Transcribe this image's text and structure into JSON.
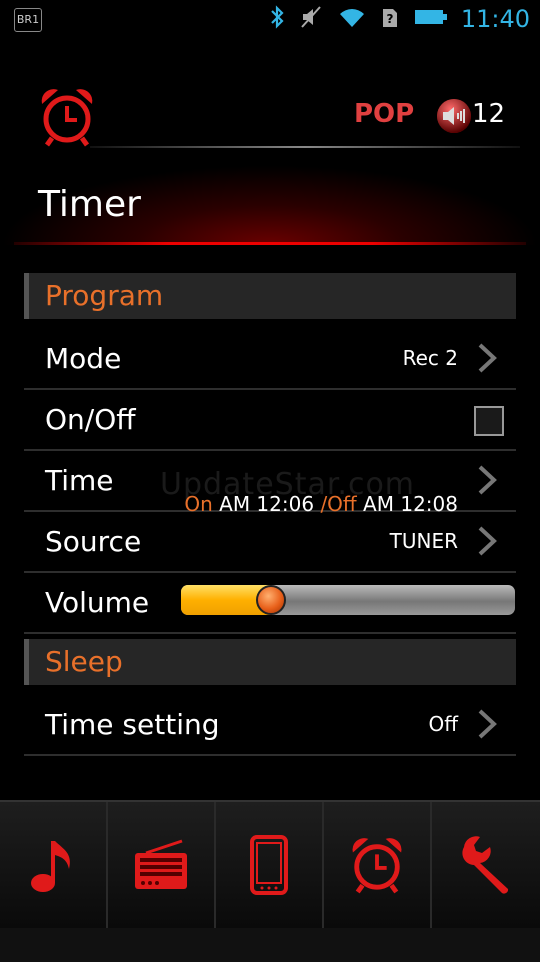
{
  "status_bar": {
    "left_badge": "BR1",
    "time": "11:40",
    "icons": [
      "bluetooth-icon",
      "mute-icon",
      "wifi-icon",
      "sim-unknown-icon",
      "battery-icon"
    ]
  },
  "header": {
    "eq_preset": "POP",
    "volume_level": "12"
  },
  "page": {
    "title": "Timer"
  },
  "sections": {
    "program": "Program",
    "sleep": "Sleep"
  },
  "rows": {
    "mode": {
      "label": "Mode",
      "value": "Rec 2"
    },
    "onoff": {
      "label": "On/Off",
      "checked": false
    },
    "time": {
      "label": "Time",
      "on_label": "On",
      "on_time": " AM 12:06 ",
      "off_label": "/Off",
      "off_time": " AM 12:08"
    },
    "source": {
      "label": "Source",
      "value": "TUNER"
    },
    "volume": {
      "label": "Volume",
      "level_fraction": 0.27
    },
    "time_setting": {
      "label": "Time setting",
      "value": "Off"
    }
  },
  "watermark": "UpdateStar.com",
  "bottom_nav": [
    {
      "name": "music-tab",
      "icon": "music-note-icon"
    },
    {
      "name": "radio-tab",
      "icon": "radio-icon"
    },
    {
      "name": "device-tab",
      "icon": "phone-icon"
    },
    {
      "name": "alarm-tab",
      "icon": "alarm-clock-icon"
    },
    {
      "name": "settings-tab",
      "icon": "wrench-icon"
    }
  ],
  "colors": {
    "accent": "#e8702a",
    "red": "#e01a1a",
    "status_blue": "#33b5e5"
  }
}
